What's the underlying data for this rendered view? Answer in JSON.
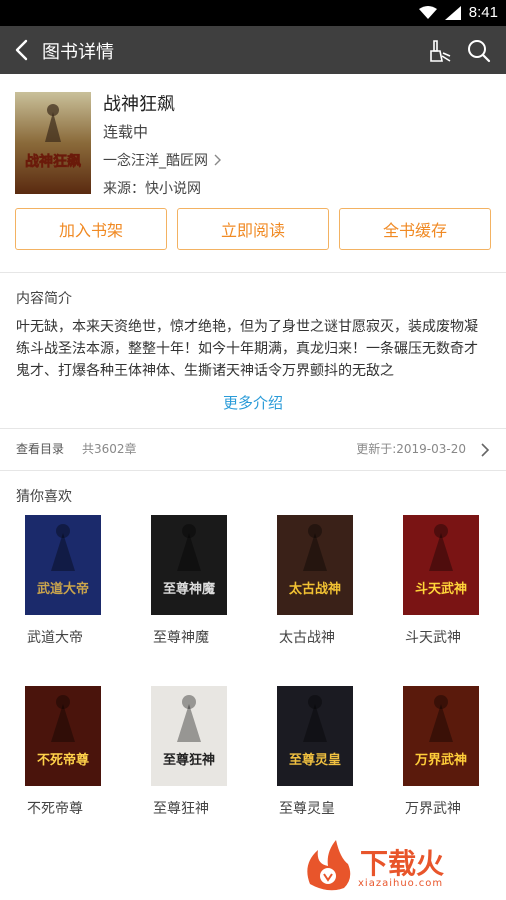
{
  "status_bar": {
    "time": "8:41"
  },
  "app_bar": {
    "title": "图书详情"
  },
  "book": {
    "title": "战神狂飙",
    "status": "连载中",
    "author": "一念汪洋_酷匠网",
    "source": "来源：快小说网",
    "cover_text": "战神狂飙"
  },
  "actions": {
    "add_shelf": "加入书架",
    "read_now": "立即阅读",
    "cache_all": "全书缓存"
  },
  "intro": {
    "title": "内容简介",
    "text": "叶无缺，本来天资绝世，惊才绝艳，但为了身世之谜甘愿寂灭，装成废物凝练斗战圣法本源，整整十年！如今十年期满，真龙归来！一条碾压无数奇才鬼才、打爆各种王体神体、生撕诸天神话令万界颤抖的无敌之",
    "more": "更多介绍"
  },
  "catalog": {
    "label": "查看目录",
    "count": "共3602章",
    "updated": "更新于:2019-03-20"
  },
  "recommend": {
    "title": "猜你喜欢",
    "items": [
      {
        "name": "武道大帝",
        "cover_text": "武道大帝",
        "bg": "#1b2a6b",
        "accent": "#c9a44c"
      },
      {
        "name": "至尊神魔",
        "cover_text": "至尊神魔",
        "bg": "#1a1a1a",
        "accent": "#ddd"
      },
      {
        "name": "太古战神",
        "cover_text": "太古战神",
        "bg": "#3a2118",
        "accent": "#f2c233"
      },
      {
        "name": "斗天武神",
        "cover_text": "斗天武神",
        "bg": "#7a1414",
        "accent": "#ffd53a"
      },
      {
        "name": "不死帝尊",
        "cover_text": "不死帝尊",
        "bg": "#4a140c",
        "accent": "#ffd24a"
      },
      {
        "name": "至尊狂神",
        "cover_text": "至尊狂神",
        "bg": "#e8e6e2",
        "accent": "#222"
      },
      {
        "name": "至尊灵皇",
        "cover_text": "至尊灵皇",
        "bg": "#1b1b22",
        "accent": "#f0c040"
      },
      {
        "name": "万界武神",
        "cover_text": "万界武神",
        "bg": "#5a1a0c",
        "accent": "#ffce3a"
      }
    ]
  },
  "watermark": {
    "main": "下载火",
    "sub": "xiazaihuo.com"
  },
  "colors": {
    "accent_orange": "#f08a24",
    "link_blue": "#2a9bd8",
    "app_bar": "#3f3f3f"
  }
}
